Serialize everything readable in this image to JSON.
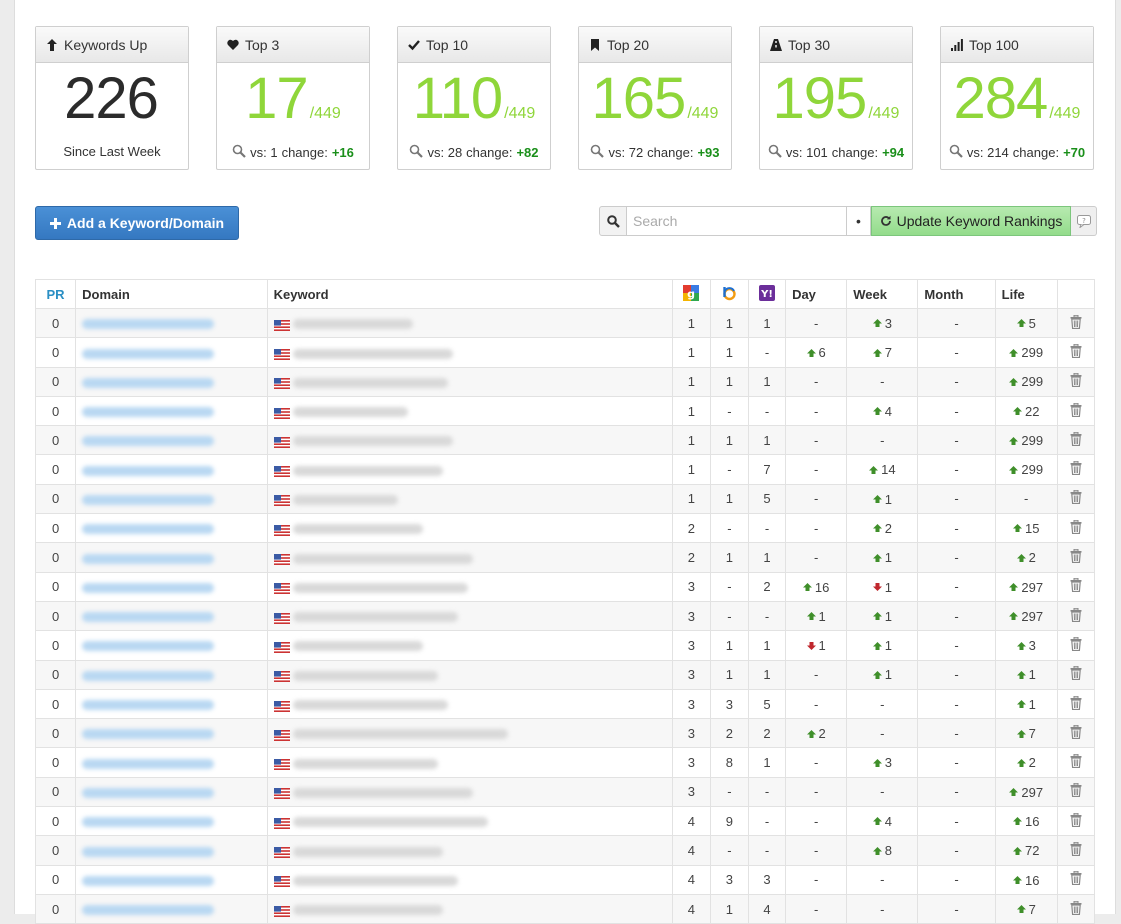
{
  "cards": [
    {
      "title": "Keywords Up",
      "icon": "arrow-up-icon",
      "value": "226",
      "of": "",
      "footer_text": "Since Last Week",
      "vs": "",
      "change_label": "",
      "change": ""
    },
    {
      "title": "Top 3",
      "icon": "heart-icon",
      "value": "17",
      "of": "/449",
      "footer_text": "vs: 1",
      "change_label": "change:",
      "change": "+16"
    },
    {
      "title": "Top 10",
      "icon": "checkmark-icon",
      "value": "110",
      "of": "/449",
      "footer_text": "vs: 28",
      "change_label": "change:",
      "change": "+82"
    },
    {
      "title": "Top 20",
      "icon": "bookmark-icon",
      "value": "165",
      "of": "/449",
      "footer_text": "vs: 72",
      "change_label": "change:",
      "change": "+93"
    },
    {
      "title": "Top 30",
      "icon": "road-icon",
      "value": "195",
      "of": "/449",
      "footer_text": "vs: 101",
      "change_label": "change:",
      "change": "+94"
    },
    {
      "title": "Top 100",
      "icon": "signal-bars-icon",
      "value": "284",
      "of": "/449",
      "footer_text": "vs: 214",
      "change_label": "change:",
      "change": "+70"
    }
  ],
  "toolbar": {
    "add_label": "Add a Keyword/Domain",
    "search_placeholder": "Search",
    "dot": "•",
    "update_label": "Update Keyword Rankings"
  },
  "table": {
    "headers": {
      "pr": "PR",
      "domain": "Domain",
      "keyword": "Keyword",
      "google": "google-icon",
      "bing": "bing-icon",
      "yahoo": "yahoo-icon",
      "day": "Day",
      "week": "Week",
      "month": "Month",
      "life": "Life"
    },
    "rows": [
      {
        "pr": "0",
        "g": "1",
        "b": "1",
        "y": "1",
        "day": "-",
        "day_dir": "",
        "week": "3",
        "week_dir": "up",
        "month": "-",
        "life": "5",
        "life_dir": "up"
      },
      {
        "pr": "0",
        "g": "1",
        "b": "1",
        "y": "-",
        "day": "6",
        "day_dir": "up",
        "week": "7",
        "week_dir": "up",
        "month": "-",
        "life": "299",
        "life_dir": "up"
      },
      {
        "pr": "0",
        "g": "1",
        "b": "1",
        "y": "1",
        "day": "-",
        "day_dir": "",
        "week": "-",
        "week_dir": "",
        "month": "-",
        "life": "299",
        "life_dir": "up"
      },
      {
        "pr": "0",
        "g": "1",
        "b": "-",
        "y": "-",
        "day": "-",
        "day_dir": "",
        "week": "4",
        "week_dir": "up",
        "month": "-",
        "life": "22",
        "life_dir": "up"
      },
      {
        "pr": "0",
        "g": "1",
        "b": "1",
        "y": "1",
        "day": "-",
        "day_dir": "",
        "week": "-",
        "week_dir": "",
        "month": "-",
        "life": "299",
        "life_dir": "up"
      },
      {
        "pr": "0",
        "g": "1",
        "b": "-",
        "y": "7",
        "day": "-",
        "day_dir": "",
        "week": "14",
        "week_dir": "up",
        "month": "-",
        "life": "299",
        "life_dir": "up"
      },
      {
        "pr": "0",
        "g": "1",
        "b": "1",
        "y": "5",
        "day": "-",
        "day_dir": "",
        "week": "1",
        "week_dir": "up",
        "month": "-",
        "life": "-",
        "life_dir": ""
      },
      {
        "pr": "0",
        "g": "2",
        "b": "-",
        "y": "-",
        "day": "-",
        "day_dir": "",
        "week": "2",
        "week_dir": "up",
        "month": "-",
        "life": "15",
        "life_dir": "up"
      },
      {
        "pr": "0",
        "g": "2",
        "b": "1",
        "y": "1",
        "day": "-",
        "day_dir": "",
        "week": "1",
        "week_dir": "up",
        "month": "-",
        "life": "2",
        "life_dir": "up"
      },
      {
        "pr": "0",
        "g": "3",
        "b": "-",
        "y": "2",
        "day": "16",
        "day_dir": "up",
        "week": "1",
        "week_dir": "down",
        "month": "-",
        "life": "297",
        "life_dir": "up"
      },
      {
        "pr": "0",
        "g": "3",
        "b": "-",
        "y": "-",
        "day": "1",
        "day_dir": "up",
        "week": "1",
        "week_dir": "up",
        "month": "-",
        "life": "297",
        "life_dir": "up"
      },
      {
        "pr": "0",
        "g": "3",
        "b": "1",
        "y": "1",
        "day": "1",
        "day_dir": "down",
        "week": "1",
        "week_dir": "up",
        "month": "-",
        "life": "3",
        "life_dir": "up"
      },
      {
        "pr": "0",
        "g": "3",
        "b": "1",
        "y": "1",
        "day": "-",
        "day_dir": "",
        "week": "1",
        "week_dir": "up",
        "month": "-",
        "life": "1",
        "life_dir": "up"
      },
      {
        "pr": "0",
        "g": "3",
        "b": "3",
        "y": "5",
        "day": "-",
        "day_dir": "",
        "week": "-",
        "week_dir": "",
        "month": "-",
        "life": "1",
        "life_dir": "up"
      },
      {
        "pr": "0",
        "g": "3",
        "b": "2",
        "y": "2",
        "day": "2",
        "day_dir": "up",
        "week": "-",
        "week_dir": "",
        "month": "-",
        "life": "7",
        "life_dir": "up"
      },
      {
        "pr": "0",
        "g": "3",
        "b": "8",
        "y": "1",
        "day": "-",
        "day_dir": "",
        "week": "3",
        "week_dir": "up",
        "month": "-",
        "life": "2",
        "life_dir": "up"
      },
      {
        "pr": "0",
        "g": "3",
        "b": "-",
        "y": "-",
        "day": "-",
        "day_dir": "",
        "week": "-",
        "week_dir": "",
        "month": "-",
        "life": "297",
        "life_dir": "up"
      },
      {
        "pr": "0",
        "g": "4",
        "b": "9",
        "y": "-",
        "day": "-",
        "day_dir": "",
        "week": "4",
        "week_dir": "up",
        "month": "-",
        "life": "16",
        "life_dir": "up"
      },
      {
        "pr": "0",
        "g": "4",
        "b": "-",
        "y": "-",
        "day": "-",
        "day_dir": "",
        "week": "8",
        "week_dir": "up",
        "month": "-",
        "life": "72",
        "life_dir": "up"
      },
      {
        "pr": "0",
        "g": "4",
        "b": "3",
        "y": "3",
        "day": "-",
        "day_dir": "",
        "week": "-",
        "week_dir": "",
        "month": "-",
        "life": "16",
        "life_dir": "up"
      },
      {
        "pr": "0",
        "g": "4",
        "b": "1",
        "y": "4",
        "day": "-",
        "day_dir": "",
        "week": "-",
        "week_dir": "",
        "month": "-",
        "life": "7",
        "life_dir": "up"
      }
    ]
  },
  "colors": {
    "accent_green": "#8fd63a",
    "change_green": "#1a8f1a",
    "primary_blue": "#3578c1",
    "arrow_up": "#3f8f2a",
    "arrow_down": "#c0272d"
  }
}
